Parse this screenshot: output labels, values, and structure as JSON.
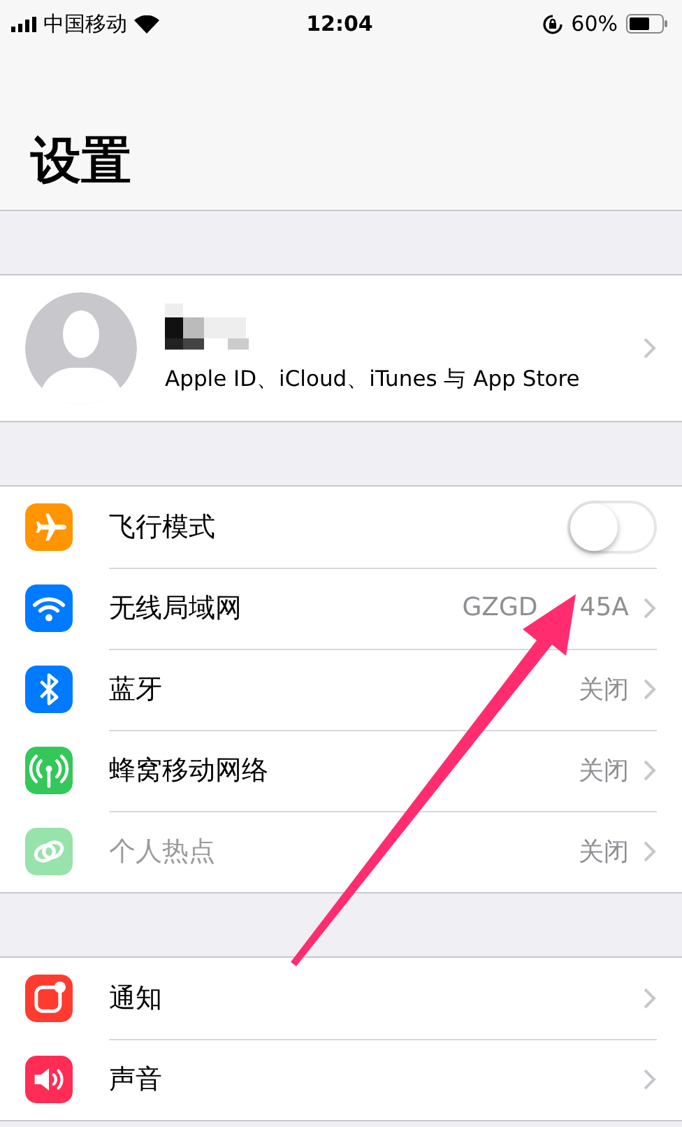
{
  "status_bar": {
    "carrier": "中国移动",
    "time": "12:04",
    "battery": "60%"
  },
  "title": "设置",
  "profile": {
    "subtitle": "Apple ID、iCloud、iTunes 与 App Store"
  },
  "groups": [
    {
      "rows": [
        {
          "kind": "toggle",
          "label": "飞行模式",
          "on": false,
          "disabled": false
        },
        {
          "kind": "link",
          "label": "无线局域网",
          "value_parts": [
            "GZGD",
            "45A"
          ],
          "disabled": false
        },
        {
          "kind": "link",
          "label": "蓝牙",
          "value_parts": [
            "关闭"
          ],
          "disabled": false
        },
        {
          "kind": "link",
          "label": "蜂窝移动网络",
          "value_parts": [
            "关闭"
          ],
          "disabled": false
        },
        {
          "kind": "link",
          "label": "个人热点",
          "value_parts": [
            "关闭"
          ],
          "disabled": true
        }
      ]
    },
    {
      "rows": [
        {
          "kind": "link",
          "label": "通知",
          "disabled": false
        },
        {
          "kind": "link",
          "label": "声音",
          "disabled": false
        }
      ]
    }
  ]
}
